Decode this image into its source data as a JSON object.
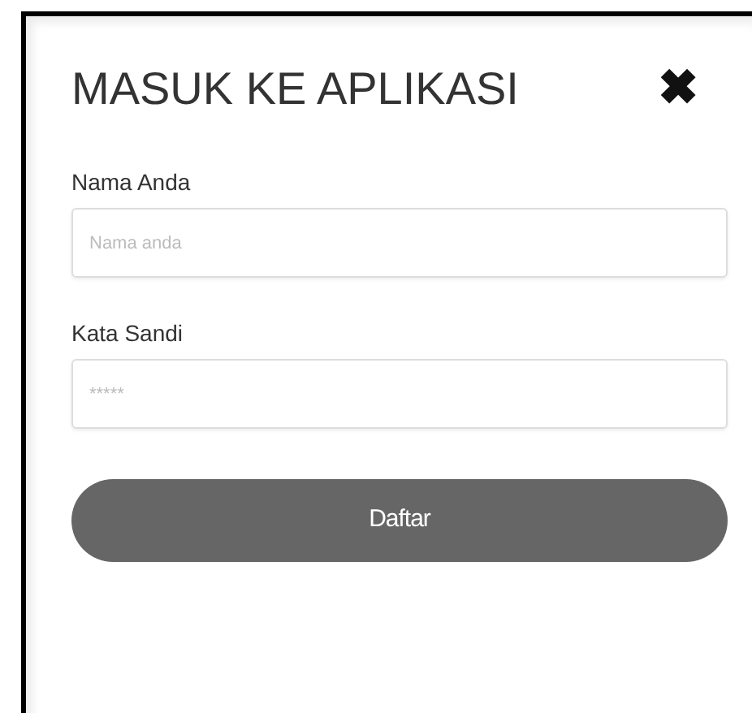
{
  "dialog": {
    "title": "MASUK KE APLIKASI",
    "close_glyph": "✖"
  },
  "fields": [
    {
      "label": "Nama Anda",
      "placeholder": "Nama anda"
    },
    {
      "label": "Kata Sandi",
      "placeholder": "*****"
    }
  ],
  "submit": {
    "label": "Daftar"
  }
}
